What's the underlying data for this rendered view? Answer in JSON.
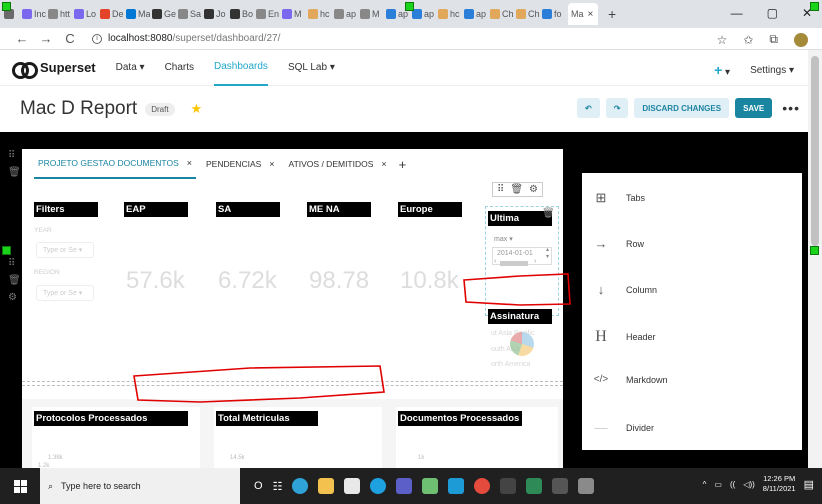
{
  "browser": {
    "tabs": [
      {
        "label": "",
        "color": "#6a6a6a"
      },
      {
        "label": "Inc",
        "color": "#7b68ee"
      },
      {
        "label": "htt",
        "color": "#888888"
      },
      {
        "label": "Lo",
        "color": "#7b68ee"
      },
      {
        "label": "De",
        "color": "#e24329"
      },
      {
        "label": "Ma",
        "color": "#0078d4"
      },
      {
        "label": "Ge",
        "color": "#333333"
      },
      {
        "label": "Sa",
        "color": "#888888"
      },
      {
        "label": "Jo",
        "color": "#333333"
      },
      {
        "label": "Bo",
        "color": "#333333"
      },
      {
        "label": "En",
        "color": "#888888"
      },
      {
        "label": "M",
        "color": "#7b68ee"
      },
      {
        "label": "hc",
        "color": "#e1a75b"
      },
      {
        "label": "ap",
        "color": "#888888"
      },
      {
        "label": "M",
        "color": "#888888"
      },
      {
        "label": "ap",
        "color": "#2b7fd8"
      },
      {
        "label": "ap",
        "color": "#2b7fd8"
      },
      {
        "label": "hc",
        "color": "#e1a75b"
      },
      {
        "label": "ap",
        "color": "#2b7fd8"
      },
      {
        "label": "Ch",
        "color": "#e1a75b"
      },
      {
        "label": "Ch",
        "color": "#e1a75b"
      },
      {
        "label": "fo",
        "color": "#2b7fd8"
      }
    ],
    "active_tab": "Ma",
    "tab_close": "×",
    "new_tab": "+",
    "window_controls": [
      "—",
      "▢",
      "✕"
    ],
    "url_host": "localhost:8080",
    "url_path": "/superset/dashboard/27/",
    "info_glyph": "i",
    "nav_icons": [
      "←",
      "→",
      "C"
    ],
    "addr_icons": [
      "☆",
      "✩",
      "⧉"
    ]
  },
  "nav": {
    "brand": "Superset",
    "items": [
      "Data ▾",
      "Charts",
      "Dashboards",
      "SQL Lab ▾"
    ],
    "active": "Dashboards",
    "plus": "+",
    "plus_caret": "▾",
    "settings": "Settings ▾"
  },
  "header": {
    "title": "Mac D Report",
    "badge": "Draft",
    "star": "★",
    "undo": "↶",
    "redo": "↷",
    "discard": "DISCARD CHANGES",
    "save": "SAVE",
    "more": "•••"
  },
  "dashboard_tabs": [
    {
      "label": "PROJETO GESTAO DOCUMENTOS",
      "active": true
    },
    {
      "label": "PENDENCIAS",
      "active": false
    },
    {
      "label": "ATIVOS / DEMITIDOS",
      "active": false
    }
  ],
  "tab_close": "×",
  "tab_add": "+",
  "drag_handle": "⠿",
  "trash_glyph": "🗑",
  "gear_glyph": "⚙",
  "panel_tools": [
    "⠿",
    "🗑",
    "⚙"
  ],
  "filters": {
    "title": "Filters",
    "year_label": "YEAR",
    "region_label": "REGION",
    "placeholder": "Type or Se ▾"
  },
  "big_numbers": [
    {
      "title": "EAP",
      "value": "57.6k"
    },
    {
      "title": "SA",
      "value": "6.72k"
    },
    {
      "title": "ME NA",
      "value": "98.78"
    },
    {
      "title": "Europe",
      "value": "10.8k"
    }
  ],
  "ultima": {
    "title": "Ultima",
    "field": "max",
    "field_caret": "▾",
    "value": "2014-01-01",
    "arrow_left": "‹",
    "arrow_right": "›",
    "spin_up": "▴",
    "spin_down": "▾"
  },
  "assinatura": {
    "title": "Assinatura",
    "faded_lines": [
      "ut Asia Pacific",
      "outh Asia",
      "orth America"
    ]
  },
  "bottom_charts": [
    {
      "title": "Protocolos Processados",
      "axis": [
        "1.38k",
        "1.2k"
      ]
    },
    {
      "title": "Total Metriculas",
      "axis": [
        "14.5k"
      ]
    },
    {
      "title": "Documentos Processados",
      "axis": [
        "1k"
      ]
    }
  ],
  "insert_panel": [
    {
      "label": "Tabs",
      "icon": "⊞"
    },
    {
      "label": "Row",
      "icon": "→"
    },
    {
      "label": "Column",
      "icon": "↓"
    },
    {
      "label": "Header",
      "icon": "H"
    },
    {
      "label": "Markdown",
      "icon": "</>"
    },
    {
      "label": "Divider",
      "icon": "—"
    }
  ],
  "taskbar": {
    "search_placeholder": "Type here to search",
    "search_glyph": "⌕",
    "task_view": "O",
    "apps_glyph": "☷",
    "tray_icons": [
      "^",
      "▭",
      "((",
      "◁))"
    ],
    "notification": "▤",
    "time": "12:26 PM",
    "date": "8/11/2021"
  },
  "colors": {
    "accent": "#20a7c9",
    "primary_button": "#1a85a0",
    "star": "#fcc700",
    "annotation_red": "#e00000",
    "handle_green": "#1bd31b"
  }
}
